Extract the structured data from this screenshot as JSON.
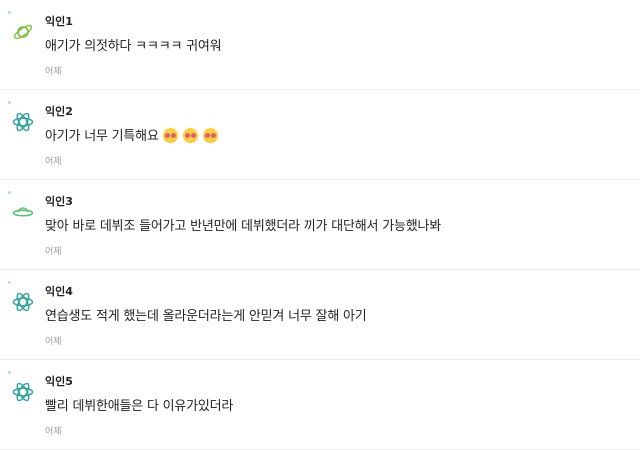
{
  "comments": [
    {
      "author": "익인1",
      "text": "애기가 의젓하다 ㅋㅋㅋㅋ 귀여워",
      "time": "어제",
      "avatar_icon": "saturn-icon",
      "avatar_color": "#7fbf3f"
    },
    {
      "author": "익인2",
      "text": "아기가 너무 기특해요",
      "emojis": [
        "pleading-face-emoji",
        "pleading-face-emoji",
        "pleading-face-emoji"
      ],
      "time": "어제",
      "avatar_icon": "atom-icon",
      "avatar_color": "#2aa39a"
    },
    {
      "author": "익인3",
      "text": "맞아 바로 데뷔조 들어가고 반년만에 데뷔했더라 끼가 대단해서 가능했나봐",
      "time": "어제",
      "avatar_icon": "ufo-icon",
      "avatar_color": "#5bbf73"
    },
    {
      "author": "익인4",
      "text": "연습생도 적게 했는데 올라운더라는게 안믿겨 너무 잘해 아기",
      "time": "어제",
      "avatar_icon": "atom-icon",
      "avatar_color": "#2aa39a"
    },
    {
      "author": "익인5",
      "text": "빨리 데뷔한애들은 다 이유가있더라",
      "time": "어제",
      "avatar_icon": "atom-icon",
      "avatar_color": "#2aa39a"
    }
  ]
}
